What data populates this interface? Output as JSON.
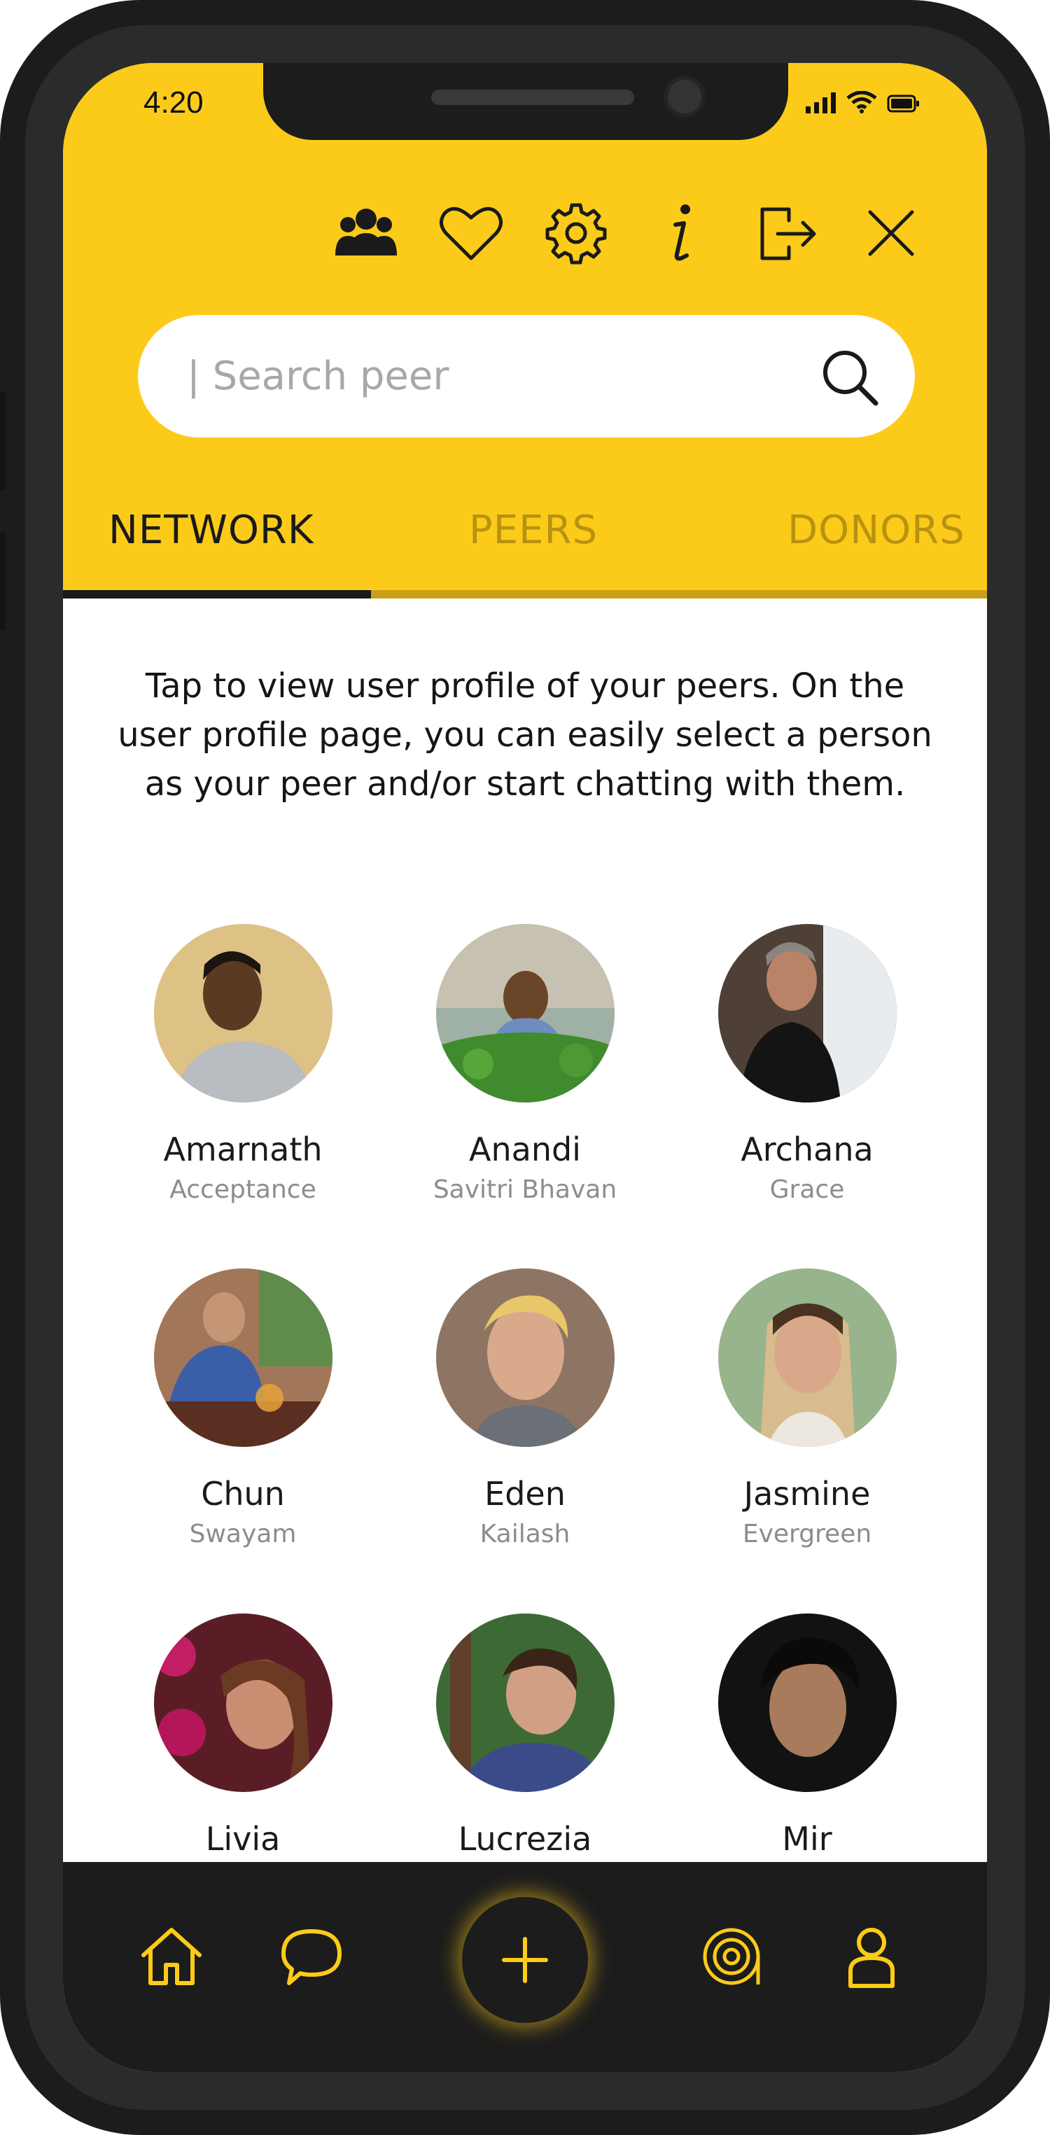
{
  "status_bar": {
    "time": "4:20"
  },
  "search": {
    "placeholder": "| Search peer"
  },
  "tabs": [
    {
      "label": "NETWORK",
      "active": true
    },
    {
      "label": "PEERS",
      "active": false
    },
    {
      "label": "DONORS",
      "active": false
    }
  ],
  "intro_text": "Tap to view user profile of your peers. On the user profile page, you can easily select a person as your peer and/or start chatting with them.",
  "people": [
    {
      "name": "Amarnath",
      "sub": "Acceptance"
    },
    {
      "name": "Anandi",
      "sub": "Savitri Bhavan"
    },
    {
      "name": "Archana",
      "sub": "Grace"
    },
    {
      "name": "Chun",
      "sub": "Swayam"
    },
    {
      "name": "Eden",
      "sub": "Kailash"
    },
    {
      "name": "Jasmine",
      "sub": "Evergreen"
    },
    {
      "name": "Livia",
      "sub": ""
    },
    {
      "name": "Lucrezia",
      "sub": ""
    },
    {
      "name": "Mir",
      "sub": ""
    }
  ],
  "colors": {
    "accent": "#fccb19",
    "dark": "#1c1c1c",
    "tab_inactive": "#b8920f"
  },
  "icons": {
    "toolbar": [
      "group-icon",
      "heart-icon",
      "gear-icon",
      "info-icon",
      "logout-icon",
      "close-icon"
    ],
    "bottom_nav": [
      "home-icon",
      "chat-icon",
      "plus-icon",
      "target-icon",
      "profile-icon"
    ]
  }
}
